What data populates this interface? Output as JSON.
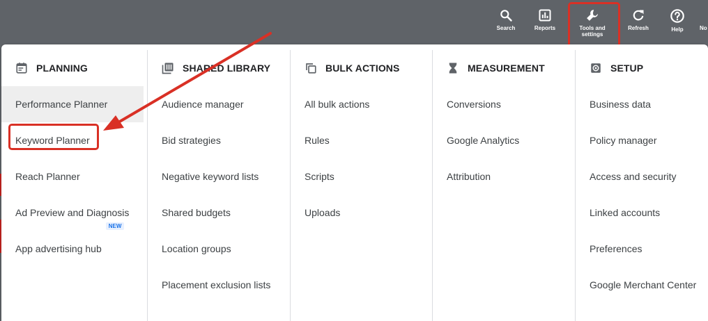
{
  "toolbar": {
    "items": [
      {
        "label": "Search",
        "icon": "search-icon"
      },
      {
        "label": "Reports",
        "icon": "reports-icon"
      },
      {
        "label": "Tools and settings",
        "icon": "wrench-icon"
      },
      {
        "label": "Refresh",
        "icon": "refresh-icon"
      },
      {
        "label": "Help",
        "icon": "help-icon"
      },
      {
        "label": "No",
        "icon": "notifications-icon"
      }
    ]
  },
  "menu": {
    "planning": {
      "title": "PLANNING",
      "icon": "calendar-icon",
      "items": [
        "Performance Planner",
        "Keyword Planner",
        "Reach Planner",
        "Ad Preview and Diagnosis",
        "App advertising hub"
      ],
      "badge": "NEW"
    },
    "shared_library": {
      "title": "SHARED LIBRARY",
      "icon": "library-icon",
      "items": [
        "Audience manager",
        "Bid strategies",
        "Negative keyword lists",
        "Shared budgets",
        "Location groups",
        "Placement exclusion lists"
      ]
    },
    "bulk_actions": {
      "title": "BULK ACTIONS",
      "icon": "copy-icon",
      "items": [
        "All bulk actions",
        "Rules",
        "Scripts",
        "Uploads"
      ]
    },
    "measurement": {
      "title": "MEASUREMENT",
      "icon": "hourglass-icon",
      "items": [
        "Conversions",
        "Google Analytics",
        "Attribution"
      ]
    },
    "setup": {
      "title": "SETUP",
      "icon": "settings-box-icon",
      "items": [
        "Business data",
        "Policy manager",
        "Access and security",
        "Linked accounts",
        "Preferences",
        "Google Merchant Center"
      ]
    }
  },
  "colors": {
    "toolbar_bg": "#5f6368",
    "annotation_red": "#d93025",
    "active_item_bg": "#eeeeee",
    "badge_blue": "#1a73e8"
  }
}
